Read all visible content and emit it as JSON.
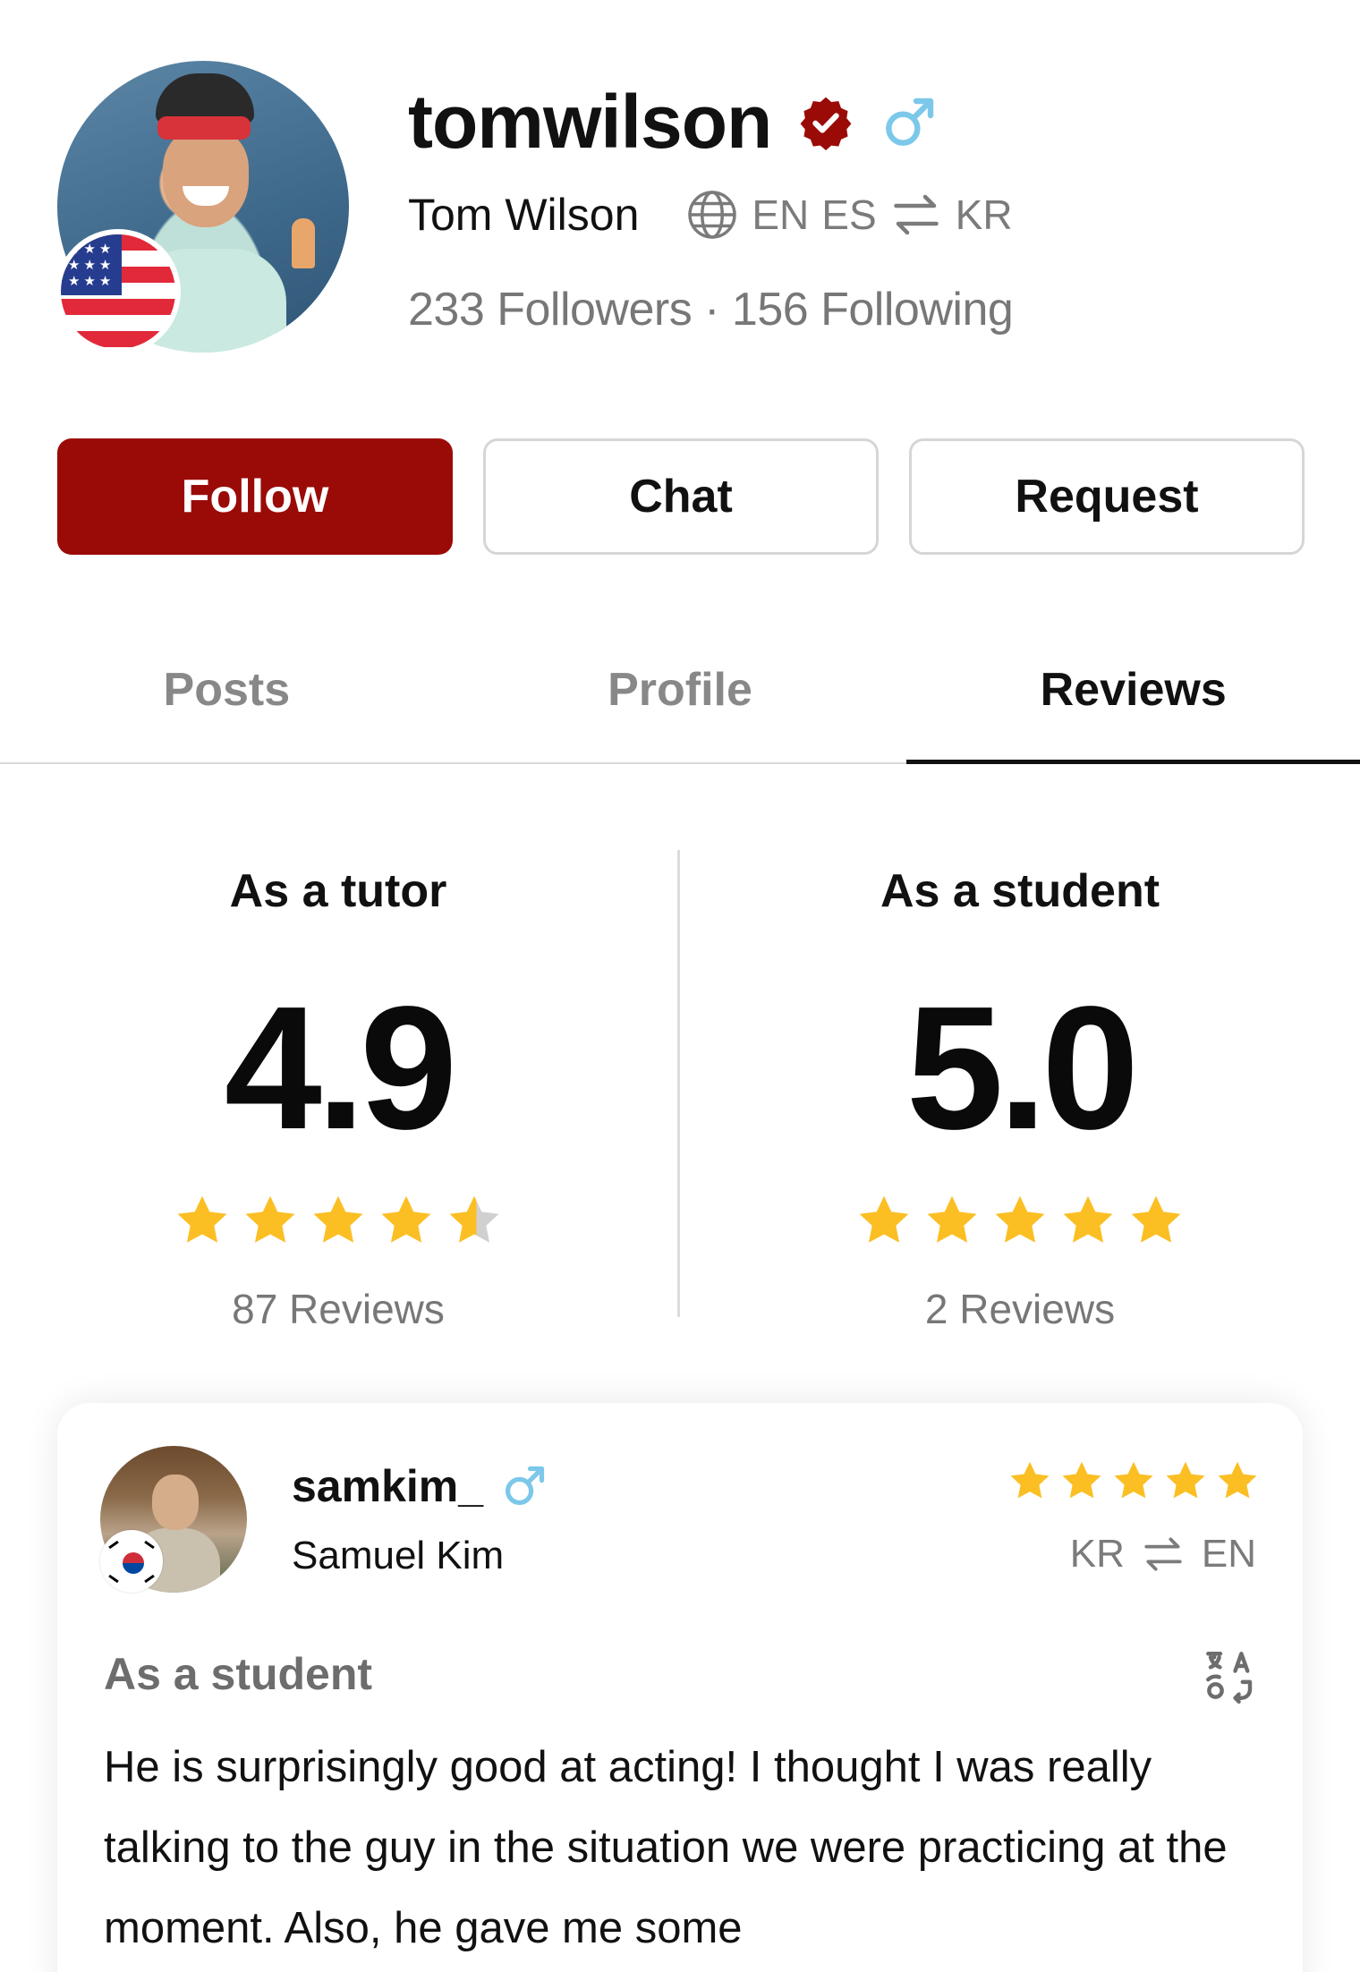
{
  "profile": {
    "username": "tomwilson",
    "full_name": "Tom Wilson",
    "languages_native": [
      "EN",
      "ES"
    ],
    "languages_target": [
      "KR"
    ],
    "followers_text": "233 Followers · 156 Following",
    "badges": {
      "verified_color": "#9a0b08",
      "gender_icon": "male-icon",
      "gender_color": "#7cc8ea"
    },
    "country_flag": "us-flag-icon"
  },
  "actions": {
    "follow_label": "Follow",
    "chat_label": "Chat",
    "request_label": "Request"
  },
  "tabs": [
    {
      "label": "Posts",
      "active": false
    },
    {
      "label": "Profile",
      "active": false
    },
    {
      "label": "Reviews",
      "active": true
    }
  ],
  "ratings": {
    "tutor": {
      "title": "As a tutor",
      "score": "4.9",
      "stars": 4.9,
      "count_text": "87 Reviews"
    },
    "student": {
      "title": "As a student",
      "score": "5.0",
      "stars": 5.0,
      "count_text": "2 Reviews"
    }
  },
  "review": {
    "username": "samkim_",
    "full_name": "Samuel Kim",
    "stars": 5,
    "lang_from": "KR",
    "lang_to": "EN",
    "role": "As a student",
    "text": "He is surprisingly good at acting! I thought I was really talking to the guy in the situation we were practicing at the moment. Also, he gave me some",
    "country_flag": "kr-flag-icon"
  },
  "colors": {
    "accent": "#9a0b08",
    "star": "#fbbf24",
    "star_empty": "#d0d0d0",
    "muted": "#7b7b7b"
  }
}
